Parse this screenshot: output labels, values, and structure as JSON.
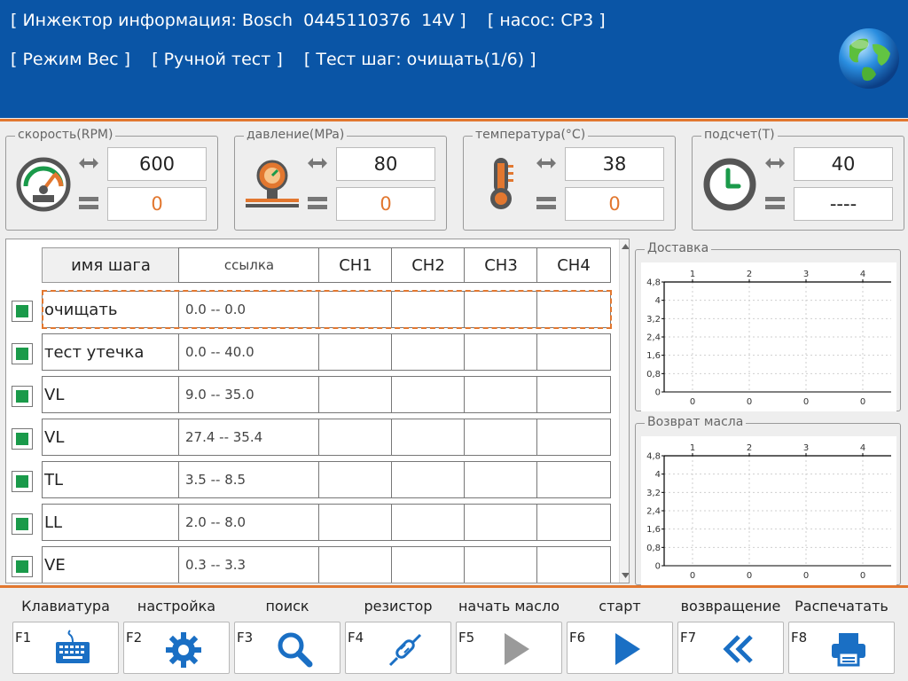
{
  "header": {
    "line1": "[ Инжектор информация: Bosch  0445110376  14V ]    [ насос: CP3 ]",
    "line2": "[ Режим Вес ]    [ Ручной тест ]    [ Тест шаг: очищать(1/6) ]"
  },
  "gauges": [
    {
      "title": "скорость(RPM)",
      "icon": "speedometer-icon",
      "set": "600",
      "actual": "0"
    },
    {
      "title": "давление(MPa)",
      "icon": "pressure-gauge-icon",
      "set": "80",
      "actual": "0"
    },
    {
      "title": "температура(°C)",
      "icon": "thermometer-icon",
      "set": "38",
      "actual": "0"
    },
    {
      "title": "подсчет(T)",
      "icon": "clock-icon",
      "set": "40",
      "actual": "----"
    }
  ],
  "table": {
    "headers": {
      "name": "имя шага",
      "ref": "ссылка",
      "ch1": "CH1",
      "ch2": "CH2",
      "ch3": "CH3",
      "ch4": "CH4"
    },
    "rows": [
      {
        "name": "очищать",
        "ref": "0.0 -- 0.0",
        "icon": "arrow-down-icon",
        "checked": true
      },
      {
        "name": "тест утечка",
        "ref": "0.0 -- 40.0",
        "icon": "arrow-up-icon",
        "checked": true
      },
      {
        "name": "VL",
        "ref": "9.0 -- 35.0",
        "icon": "arrow-up-icon",
        "checked": true
      },
      {
        "name": "VL",
        "ref": "27.4 -- 35.4",
        "icon": "arrow-down-icon",
        "checked": true
      },
      {
        "name": "TL",
        "ref": "3.5 -- 8.5",
        "icon": "arrow-down-icon",
        "checked": true
      },
      {
        "name": "LL",
        "ref": "2.0 -- 8.0",
        "icon": "arrow-down-icon",
        "checked": true
      },
      {
        "name": "VE",
        "ref": "0.3 -- 3.3",
        "icon": "arrow-down-icon",
        "checked": true
      }
    ],
    "selected_row": 0
  },
  "chart_data": [
    {
      "type": "bar",
      "title": "Доставка",
      "categories": [
        "1",
        "2",
        "3",
        "4"
      ],
      "values": [
        0,
        0,
        0,
        0
      ],
      "value_labels": [
        "0",
        "0",
        "0",
        "0"
      ],
      "yticks": [
        "4,8",
        "4",
        "3,2",
        "2,4",
        "1,6",
        "0,8",
        "0"
      ],
      "ylim": [
        0,
        4.8
      ],
      "grid": true
    },
    {
      "type": "bar",
      "title": "Возврат масла",
      "categories": [
        "1",
        "2",
        "3",
        "4"
      ],
      "values": [
        0,
        0,
        0,
        0
      ],
      "value_labels": [
        "0",
        "0",
        "0",
        "0"
      ],
      "yticks": [
        "4,8",
        "4",
        "3,2",
        "2,4",
        "1,6",
        "0,8",
        "0"
      ],
      "ylim": [
        0,
        4.8
      ],
      "grid": true
    }
  ],
  "function_keys": [
    {
      "key": "F1",
      "label": "Клавиатура",
      "icon": "keyboard-icon"
    },
    {
      "key": "F2",
      "label": "настройка",
      "icon": "gear-icon"
    },
    {
      "key": "F3",
      "label": "поиск",
      "icon": "search-icon"
    },
    {
      "key": "F4",
      "label": "резистор",
      "icon": "resistor-icon"
    },
    {
      "key": "F5",
      "label": "начать масло",
      "icon": "play-gray-icon"
    },
    {
      "key": "F6",
      "label": "старт",
      "icon": "play-icon"
    },
    {
      "key": "F7",
      "label": "возвращение",
      "icon": "double-chevron-left-icon"
    },
    {
      "key": "F8",
      "label": "Распечатать",
      "icon": "printer-icon"
    }
  ],
  "colors": {
    "header": "#0a55a6",
    "accent": "#e2772f",
    "check": "#1a9a4a",
    "icon_blue": "#1a6fc4",
    "icon_gray": "#555555"
  }
}
